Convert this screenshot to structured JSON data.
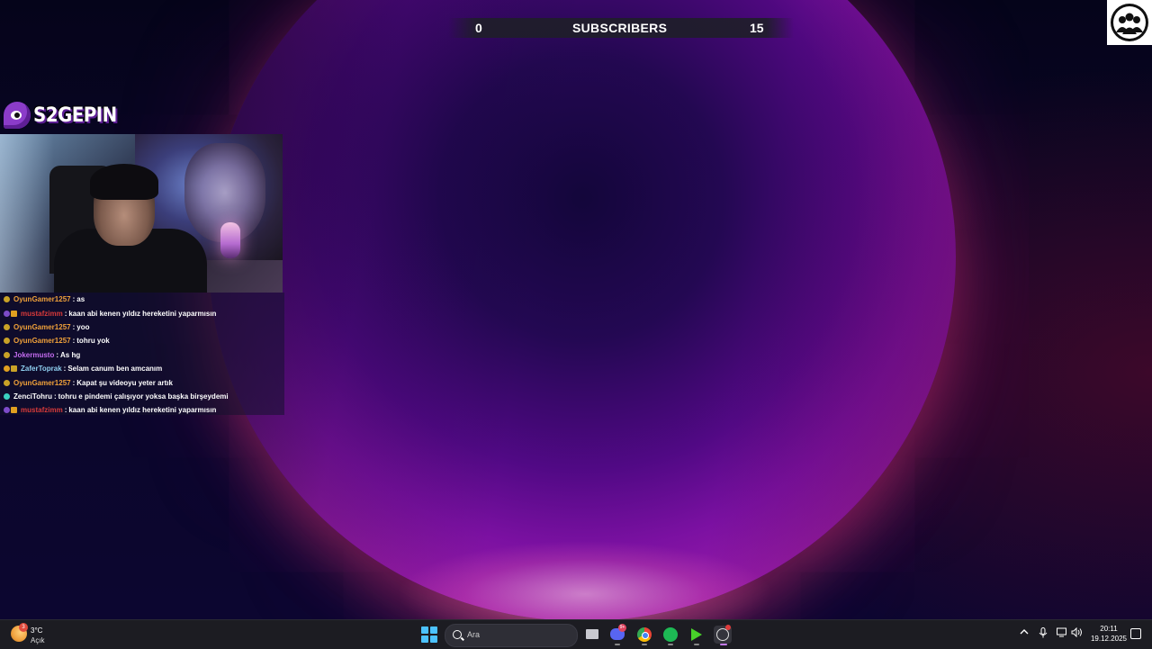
{
  "overlay": {
    "subscribers": {
      "left_count": "0",
      "label": "SUBSCRIBERS",
      "right_count": "15"
    },
    "logo_text": "S2GEPIN"
  },
  "chat": [
    {
      "user": "OyunGamer1257",
      "user_color": "#f0a13a",
      "badges": [
        "#c9a227"
      ],
      "message": "as"
    },
    {
      "user": "mustafzimm",
      "user_color": "#d83a3a",
      "badges": [
        "#7d4bc9",
        "#e0a020"
      ],
      "message": "kaan abi kenen yıldız hereketini yaparmısın"
    },
    {
      "user": "OyunGamer1257",
      "user_color": "#f0a13a",
      "badges": [
        "#c9a227"
      ],
      "message": "yoo"
    },
    {
      "user": "OyunGamer1257",
      "user_color": "#f0a13a",
      "badges": [
        "#c9a227"
      ],
      "message": "tohru yok"
    },
    {
      "user": "Jokermusto",
      "user_color": "#c46cf0",
      "badges": [
        "#c9a227"
      ],
      "message": "As hg"
    },
    {
      "user": "ZaferToprak",
      "user_color": "#8fd0f0",
      "badges": [
        "#e0a020",
        "#c9a227"
      ],
      "message": "Selam canum ben amcanım"
    },
    {
      "user": "OyunGamer1257",
      "user_color": "#f0a13a",
      "badges": [
        "#c9a227"
      ],
      "message": "Kapat şu videoyu yeter artık"
    },
    {
      "user": "ZenciTohru",
      "user_color": "#ffffff",
      "badges": [
        "#3ad0c0"
      ],
      "message": "tohru e pindemi çalışıyor yoksa başka birşeydemi"
    },
    {
      "user": "mustafzimm",
      "user_color": "#d83a3a",
      "badges": [
        "#7d4bc9",
        "#e0a020"
      ],
      "message": "kaan abi kenen yıldız hereketini yaparmısın"
    }
  ],
  "taskbar": {
    "weather": {
      "temp": "3°C",
      "condition": "Açık",
      "badge": "3"
    },
    "search_placeholder": "Ara",
    "discord_badge": "9+",
    "apps": [
      "start-icon",
      "file-explorer-icon",
      "discord-icon",
      "chrome-icon",
      "spotify-icon",
      "green-arrow-app-icon",
      "obs-icon"
    ],
    "tray": [
      "chevron-up-icon",
      "microphone-icon",
      "network-icon",
      "volume-icon"
    ],
    "time": "20:11",
    "date": "19.12.2025"
  }
}
